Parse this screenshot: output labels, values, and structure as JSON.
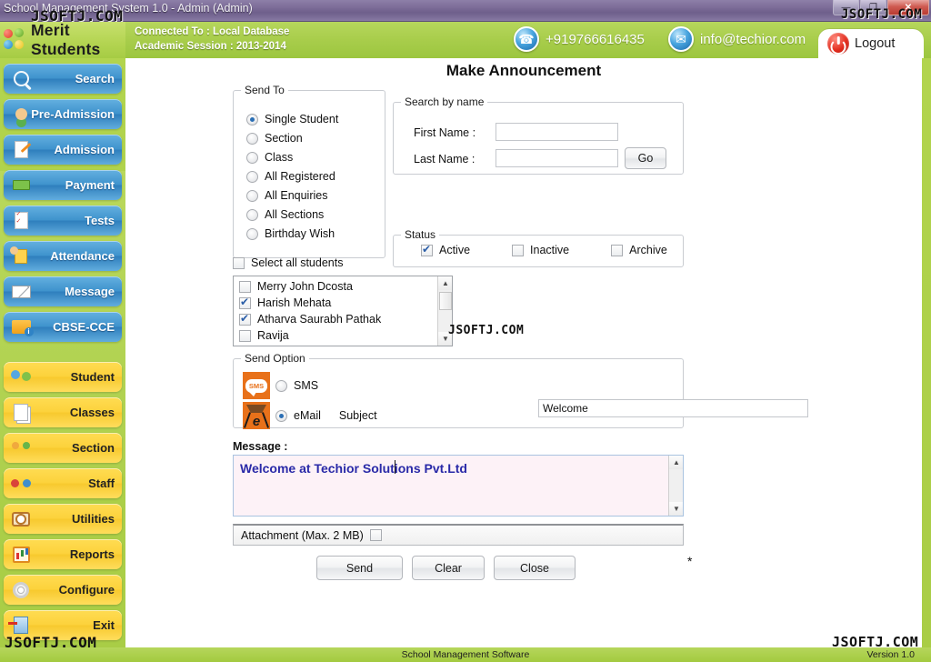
{
  "window": {
    "title": "School Management System 1.0  -  Admin (Admin)",
    "minimize_label": "—",
    "maximize_label": "❐",
    "close_label": "✕"
  },
  "watermark": {
    "text": "JSOFTJ.COM"
  },
  "header": {
    "logo_text": "Merit Students",
    "connected_to": "Connected To : Local Database",
    "academic_session": "Academic Session : 2013-2014",
    "phone": "+919766616435",
    "phone_icon": "phone-icon",
    "email": "info@techior.com",
    "email_icon": "envelope-icon",
    "logout_label": "Logout",
    "logout_icon": "power-icon",
    "accent_green": "#a8cd4b",
    "logo_dot_colors": [
      "#e23c22",
      "#5ea522",
      "#1f86c8",
      "#e8c41c"
    ]
  },
  "sidebar": {
    "blue_items": [
      {
        "label": "Search",
        "icon": "magnifier-icon"
      },
      {
        "label": "Pre-Admission",
        "icon": "person-form-icon"
      },
      {
        "label": "Admission",
        "icon": "document-pen-icon"
      },
      {
        "label": "Payment",
        "icon": "money-hand-icon"
      },
      {
        "label": "Tests",
        "icon": "checklist-icon"
      },
      {
        "label": "Attendance",
        "icon": "attendance-icon"
      },
      {
        "label": "Message",
        "icon": "envelope-icon"
      },
      {
        "label": "CBSE-CCE",
        "icon": "folder-info-icon"
      }
    ],
    "yellow_items": [
      {
        "label": "Student",
        "icon": "students-icon"
      },
      {
        "label": "Classes",
        "icon": "pages-icon"
      },
      {
        "label": "Section",
        "icon": "group-icon"
      },
      {
        "label": "Staff",
        "icon": "staff-icon"
      },
      {
        "label": "Utilities",
        "icon": "utilities-icon"
      },
      {
        "label": "Reports",
        "icon": "report-chart-icon"
      },
      {
        "label": "Configure",
        "icon": "gear-icon"
      },
      {
        "label": "Exit",
        "icon": "exit-door-icon"
      }
    ],
    "blue_color": "#3f93cd",
    "yellow_color": "#fcd23c"
  },
  "main": {
    "title": "Make Announcement",
    "send_to": {
      "legend": "Send To",
      "options": [
        {
          "label": "Single Student",
          "selected": true
        },
        {
          "label": "Section",
          "selected": false
        },
        {
          "label": "Class",
          "selected": false
        },
        {
          "label": "All Registered",
          "selected": false
        },
        {
          "label": "All Enquiries",
          "selected": false
        },
        {
          "label": "All Sections",
          "selected": false
        },
        {
          "label": "Birthday Wish",
          "selected": false
        }
      ]
    },
    "select_all": {
      "label": "Select all students",
      "checked": false
    },
    "search_by_name": {
      "legend": "Search by name",
      "first_name_label": "First Name :",
      "first_name_value": "",
      "last_name_label": "Last Name :",
      "last_name_value": "",
      "go_label": "Go"
    },
    "status": {
      "legend": "Status",
      "options": [
        {
          "label": "Active",
          "checked": true
        },
        {
          "label": "Inactive",
          "checked": false
        },
        {
          "label": "Archive",
          "checked": false
        }
      ]
    },
    "student_list": [
      {
        "label": "Merry John Dcosta",
        "checked": false
      },
      {
        "label": "Harish  Mehata",
        "checked": true
      },
      {
        "label": "Atharva Saurabh Pathak",
        "checked": true
      },
      {
        "label": "Ravija",
        "checked": false
      }
    ],
    "send_option": {
      "legend": "Send Option",
      "sms": {
        "label": "SMS",
        "selected": false,
        "icon": "sms-icon"
      },
      "email": {
        "label": "eMail",
        "selected": true,
        "icon": "email-icon"
      },
      "subject_label": "Subject",
      "subject_value": "Welcome"
    },
    "message": {
      "label": "Message :",
      "value": "Welcome at Techior Solutions Pvt.Ltd",
      "required_mark": "*"
    },
    "attachment": {
      "label": "Attachment (Max. 2 MB)",
      "checked": false
    },
    "buttons": [
      {
        "label": "Send"
      },
      {
        "label": "Clear"
      },
      {
        "label": "Close"
      }
    ]
  },
  "footer": {
    "center": "School Management Software",
    "right": "Version 1.0"
  }
}
